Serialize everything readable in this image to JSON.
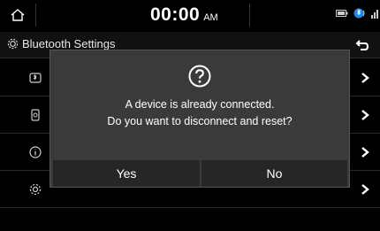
{
  "status_bar": {
    "home_icon": "home-icon",
    "time": "00:00",
    "ampm": "AM",
    "icons": [
      "battery-icon",
      "bluetooth-phone-icon",
      "signal-icon"
    ]
  },
  "header": {
    "title": "Bluetooth Settings",
    "title_icon": "gear-icon",
    "back_icon": "back-arrow-icon"
  },
  "menu": {
    "items": [
      {
        "icon": "bluetooth-device-icon",
        "chevron": "chevron-right-icon"
      },
      {
        "icon": "phone-device-icon",
        "chevron": "chevron-right-icon"
      },
      {
        "icon": "info-icon",
        "chevron": "chevron-right-icon"
      },
      {
        "icon": "gear-icon",
        "chevron": "chevron-right-icon"
      }
    ]
  },
  "dialog": {
    "icon": "question-icon",
    "line1": "A device is already connected.",
    "line2": "Do you want to disconnect and reset?",
    "yes_label": "Yes",
    "no_label": "No"
  },
  "colors": {
    "background": "#000000",
    "dialog_bg": "#3a3a3a",
    "button_bg": "#262626",
    "text": "#ffffff"
  }
}
